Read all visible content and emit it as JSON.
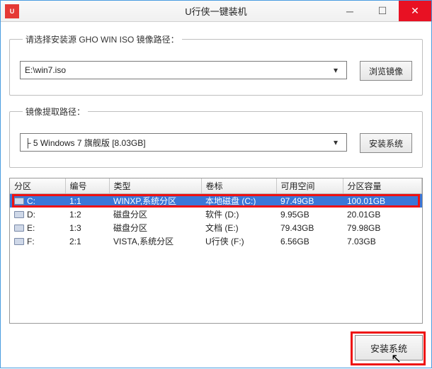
{
  "window": {
    "title": "U行侠一键装机"
  },
  "source": {
    "legend": "请选择安装源 GHO WIN ISO 镜像路径：",
    "value": "E:\\win7.iso",
    "browse_label": "浏览镜像"
  },
  "extract": {
    "legend": "镜像提取路径：",
    "value": "├ 5 Windows 7 旗舰版 [8.03GB]",
    "install_label": "安装系统"
  },
  "table": {
    "headers": [
      "分区",
      "编号",
      "类型",
      "卷标",
      "可用空间",
      "分区容量"
    ],
    "rows": [
      {
        "cells": [
          "C:",
          "1:1",
          "WINXP,系统分区",
          "本地磁盘 (C:)",
          "97.49GB",
          "100.01GB"
        ],
        "selected": true
      },
      {
        "cells": [
          "D:",
          "1:2",
          "磁盘分区",
          "软件 (D:)",
          "9.95GB",
          "20.01GB"
        ],
        "selected": false
      },
      {
        "cells": [
          "E:",
          "1:3",
          "磁盘分区",
          "文档 (E:)",
          "79.43GB",
          "79.98GB"
        ],
        "selected": false
      },
      {
        "cells": [
          "F:",
          "2:1",
          "VISTA,系统分区",
          "U行侠 (F:)",
          "6.56GB",
          "7.03GB"
        ],
        "selected": false
      }
    ]
  },
  "footer": {
    "install_label": "安装系统"
  }
}
